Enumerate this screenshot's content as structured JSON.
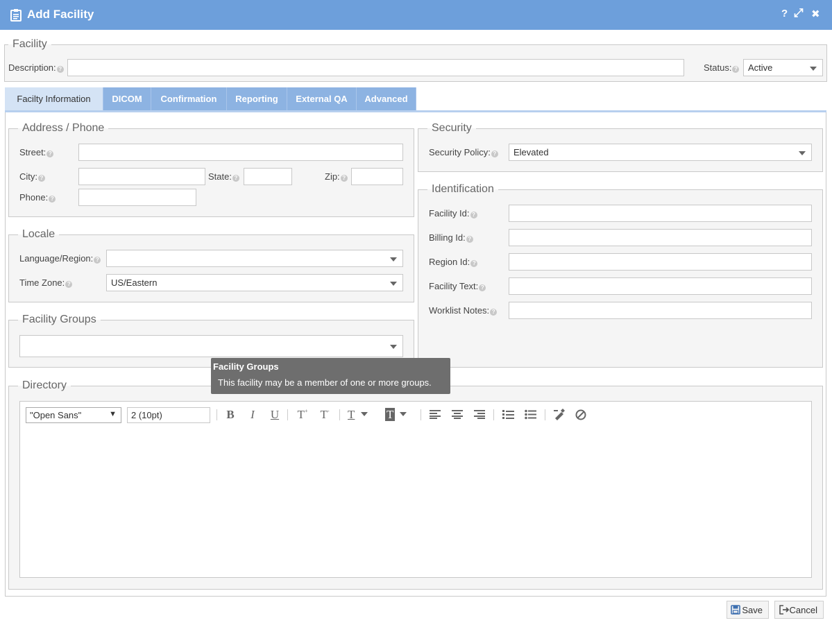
{
  "window": {
    "title": "Add Facility",
    "help_glyph": "?",
    "maximize_glyph": "⤢",
    "close_glyph": "✖"
  },
  "help_glyph": "?",
  "facility": {
    "legend": "Facility",
    "description_label": "Description:",
    "description_value": "",
    "status_label": "Status:",
    "status_value": "Active"
  },
  "tabs": [
    {
      "label": "Facilty Information",
      "active": true
    },
    {
      "label": "DICOM"
    },
    {
      "label": "Confirmation"
    },
    {
      "label": "Reporting"
    },
    {
      "label": "External QA"
    },
    {
      "label": "Advanced"
    }
  ],
  "address": {
    "legend": "Address / Phone",
    "street_label": "Street:",
    "street_value": "",
    "city_label": "City:",
    "city_value": "",
    "state_label": "State:",
    "state_value": "",
    "zip_label": "Zip:",
    "zip_value": "",
    "phone_label": "Phone:",
    "phone_value": ""
  },
  "locale": {
    "legend": "Locale",
    "language_label": "Language/Region:",
    "language_value": "",
    "timezone_label": "Time Zone:",
    "timezone_value": "US/Eastern"
  },
  "facility_groups": {
    "legend": "Facility Groups",
    "value": ""
  },
  "tooltip": {
    "title": "Facility Groups",
    "body": "This facility may be a member of one or more groups."
  },
  "security": {
    "legend": "Security",
    "policy_label": "Security Policy:",
    "policy_value": "Elevated"
  },
  "identification": {
    "legend": "Identification",
    "facility_id_label": "Facility Id:",
    "billing_id_label": "Billing Id:",
    "region_id_label": "Region Id:",
    "facility_text_label": "Facility Text:",
    "worklist_notes_label": "Worklist Notes:"
  },
  "directory": {
    "legend": "Directory",
    "font_value": "\"Open Sans\"",
    "font_caret": "▼",
    "size_value": "2 (10pt)",
    "content": "",
    "buttons": {
      "bold": "B",
      "italic": "I",
      "underline": "U",
      "superscript": "T",
      "subscript": "T",
      "text_color": "T",
      "background_color": "T"
    }
  },
  "footer": {
    "save_label": "Save",
    "cancel_label": "Cancel"
  },
  "colors": {
    "titlebar": "#6d9fdb",
    "tab": "#8db3e2",
    "tab_active": "#d4e3f5",
    "tooltip": "#6e6e6e"
  }
}
